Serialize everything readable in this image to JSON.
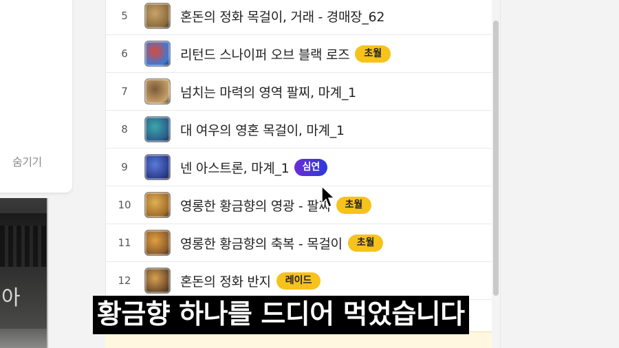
{
  "sidebar": {
    "hide_label": "숨기기"
  },
  "video_thumbnail": {
    "text": "아"
  },
  "items": [
    {
      "num": "5",
      "name": "혼돈의 정화 목걸이, 거래 - 경매장_62",
      "badge": "",
      "badge_style": "",
      "icon": "chaos-necklace-icon",
      "icon_colors": [
        "#c9a26a",
        "#8a6a3a"
      ]
    },
    {
      "num": "6",
      "name": "리턴드 스나이퍼 오브 블랙 로즈",
      "badge": "초월",
      "badge_style": "yellow",
      "icon": "sniper-weapon-icon",
      "icon_colors": [
        "#d94a3a",
        "#3a7ad9"
      ]
    },
    {
      "num": "7",
      "name": "넘치는 마력의 영역 팔찌, 마계_1",
      "badge": "",
      "badge_style": "",
      "icon": "bracelet-icon",
      "icon_colors": [
        "#7a5a3a",
        "#c9a26a"
      ]
    },
    {
      "num": "8",
      "name": "대 여우의 영혼 목걸이, 마계_1",
      "badge": "",
      "badge_style": "",
      "icon": "fox-necklace-icon",
      "icon_colors": [
        "#3aa8a8",
        "#2a5a8a"
      ]
    },
    {
      "num": "9",
      "name": "넨 아스트론, 마계_1",
      "badge": "심연",
      "badge_style": "purple",
      "icon": "astron-icon",
      "icon_colors": [
        "#5a7ad9",
        "#2a3a8a"
      ]
    },
    {
      "num": "10",
      "name": "영롱한 황금향의 영광 - 팔찌",
      "badge": "초월",
      "badge_style": "yellow",
      "icon": "golden-bracelet-icon",
      "icon_colors": [
        "#e0b050",
        "#a06a2a"
      ]
    },
    {
      "num": "11",
      "name": "영롱한 황금향의 축복 - 목걸이",
      "badge": "초월",
      "badge_style": "yellow",
      "icon": "golden-necklace-icon",
      "icon_colors": [
        "#e0a040",
        "#8a5a2a"
      ]
    },
    {
      "num": "12",
      "name": "혼돈의 정화 반지",
      "badge": "레이드",
      "badge_style": "yellow",
      "icon": "chaos-ring-icon",
      "icon_colors": [
        "#d9a050",
        "#6a4a2a"
      ]
    }
  ],
  "subtitle": "황금향 하나를 드디어 먹었습니다"
}
